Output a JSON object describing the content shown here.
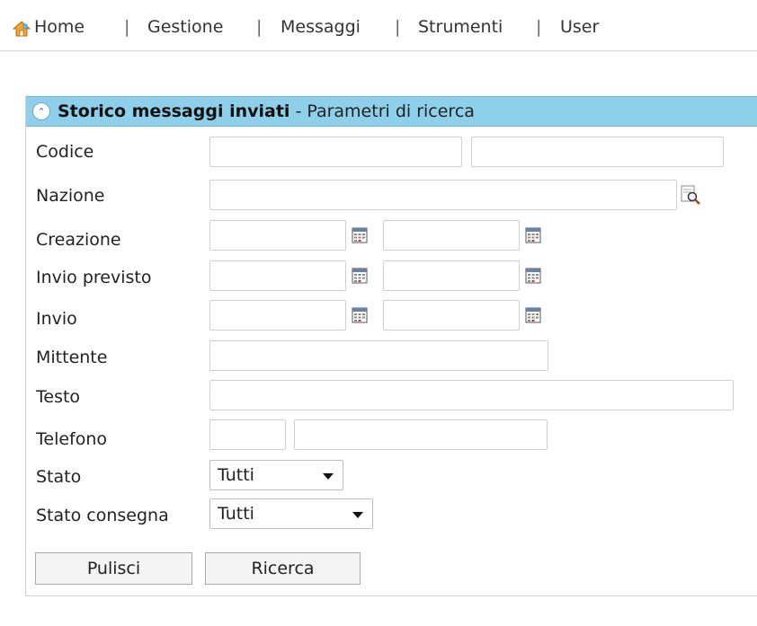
{
  "nav": {
    "items": [
      "Home",
      "Gestione",
      "Messaggi",
      "Strumenti",
      "User"
    ],
    "separator": "|"
  },
  "panel": {
    "title": "Storico messaggi inviati",
    "subtitle": "- Parametri di ricerca"
  },
  "form": {
    "labels": {
      "codice": "Codice",
      "nazione": "Nazione",
      "creazione": "Creazione",
      "invio_previsto": "Invio previsto",
      "invio": "Invio",
      "mittente": "Mittente",
      "testo": "Testo",
      "telefono": "Telefono",
      "stato": "Stato",
      "stato_consegna": "Stato consegna"
    },
    "stato_value": "Tutti",
    "stato_consegna_value": "Tutti"
  },
  "buttons": {
    "pulisci": "Pulisci",
    "ricerca": "Ricerca"
  },
  "icons": {
    "home": "home-icon",
    "collapse": "collapse-up-icon",
    "calendar": "calendar-icon",
    "lookup": "magnifier-lookup-icon"
  },
  "colors": {
    "header_bg": "#8ecfe9",
    "border": "#cfcfcf"
  }
}
